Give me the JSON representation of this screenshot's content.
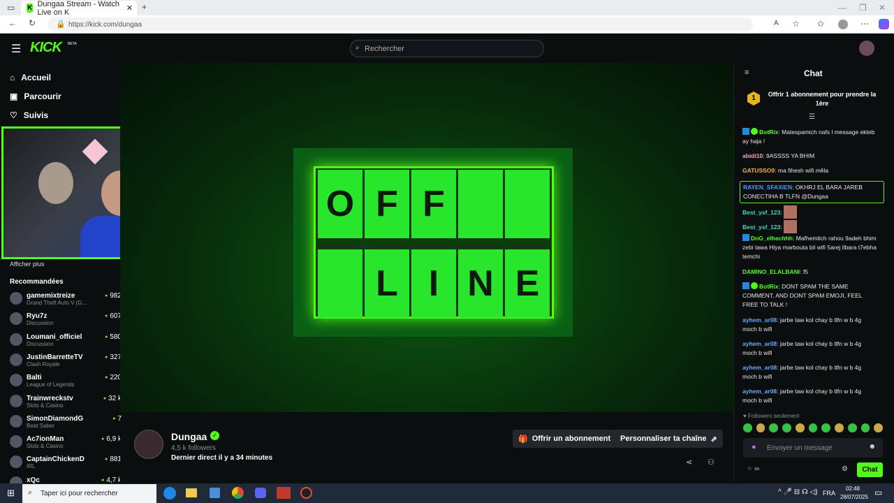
{
  "browser": {
    "tab_title": "Dungaa Stream - Watch Live on K",
    "url": "https://kick.com/dungaa"
  },
  "header": {
    "logo": "KICK",
    "logo_badge": "BETA",
    "search_placeholder": "Rechercher"
  },
  "sidebar": {
    "nav": [
      {
        "label": "Accueil",
        "icon": "home-icon"
      },
      {
        "label": "Parcourir",
        "icon": "compass-icon"
      },
      {
        "label": "Suivis",
        "icon": "heart-icon"
      }
    ],
    "show_more": "Afficher plus",
    "recommended_title": "Recommandées",
    "recommended": [
      {
        "name": "gamemixtreize",
        "category": "Grand Theft Auto V (G...",
        "viewers": "982"
      },
      {
        "name": "Ryu7z",
        "category": "Discussion",
        "viewers": "607"
      },
      {
        "name": "Loumani_officiel",
        "category": "Discussion",
        "viewers": "580"
      },
      {
        "name": "JustinBarretteTV",
        "category": "Clash Royale",
        "viewers": "327"
      },
      {
        "name": "Balti",
        "category": "League of Legends",
        "viewers": "220"
      },
      {
        "name": "Trainwreckstv",
        "category": "Slots & Casino",
        "viewers": "32 k"
      },
      {
        "name": "SimonDiamondG",
        "category": "Beat Saber",
        "viewers": "7"
      },
      {
        "name": "Ac7ionMan",
        "category": "Slots & Casino",
        "viewers": "6,9 k"
      },
      {
        "name": "CaptainChickenD",
        "category": "IRL",
        "viewers": "881"
      },
      {
        "name": "xQc",
        "category": "",
        "viewers": "4,7 k"
      }
    ]
  },
  "player": {
    "tiles_top": [
      "O",
      "F",
      "F",
      "",
      ""
    ],
    "tiles_bottom": [
      "",
      "L",
      "I",
      "N",
      "E"
    ]
  },
  "channel": {
    "name": "Dungaa",
    "followers": "4,5 k followers",
    "last_live": "Dernier direct il y a 34 minutes",
    "subscribe_label": "Offrir un abonnement",
    "customize_label": "Personnaliser ta chaîne"
  },
  "chat": {
    "title": "Chat",
    "gift_text": "Offrir 1 abonnement pour prendre la 1ère",
    "messages": [
      {
        "user": "BotRix",
        "text": "Matespamich nafs l message ekteb ay haja !",
        "color": "#53fc18"
      },
      {
        "user": "abidi10",
        "text": "9ASSSS YA BHIM",
        "color": "#f2a7c6"
      },
      {
        "user": "GATUSSO9",
        "text": "ma fihesh wifi mêla",
        "color": "#f5b04a"
      },
      {
        "user": "RAYEN_SFAXIEN",
        "text": "OKHRJ EL BARA JAREB CONECTIHA B TLFN @Dungaa",
        "color": "#3f9cff"
      },
      {
        "user": "Best_ysf_123",
        "text": "",
        "color": "#3ddbc0"
      },
      {
        "user": "Best_ysf_123",
        "text": "",
        "color": "#3ddbc0"
      },
      {
        "user": "DnG_elhechhh",
        "text": "Mafhemtich rahou 9adeh bhim zebi tawa Hiya marbouta bil wifi 5arej ilbara t7ebha temchi",
        "color": "#53fc18"
      },
      {
        "user": "DAMINO_ELALBANI",
        "text": "f5",
        "color": "#53fc18"
      },
      {
        "user": "BotRix",
        "text": "DONT SPAM THE SAME COMMENT, AND DONT SPAM EMOJI, FEEL FREE TO TALK !",
        "color": "#53fc18"
      },
      {
        "user": "ayhem_ar08",
        "text": "jarbe taw kol chay b tlfn w b 4g moch b wifi",
        "color": "#6aa8ff"
      },
      {
        "user": "ayhem_ar08",
        "text": "jarbe taw kol chay b tlfn w b 4g moch b wifi",
        "color": "#6aa8ff"
      },
      {
        "user": "ayhem_ar08",
        "text": "jarbe taw kol chay b tlfn w b 4g moch b wifi",
        "color": "#6aa8ff"
      },
      {
        "user": "ayhem_ar08",
        "text": "jarbe taw kol chay b tlfn w b 4g moch b wifi",
        "color": "#6aa8ff"
      }
    ],
    "followers_only": "Followers seulement",
    "input_placeholder": "Envoyer un message",
    "send_label": "Chat"
  },
  "taskbar": {
    "search_placeholder": "Taper ici pour rechercher",
    "lang": "FRA",
    "time": "02:48",
    "date": "28/07/2025"
  },
  "colors": {
    "accent": "#53fc18",
    "background": "#0b0e0f"
  }
}
